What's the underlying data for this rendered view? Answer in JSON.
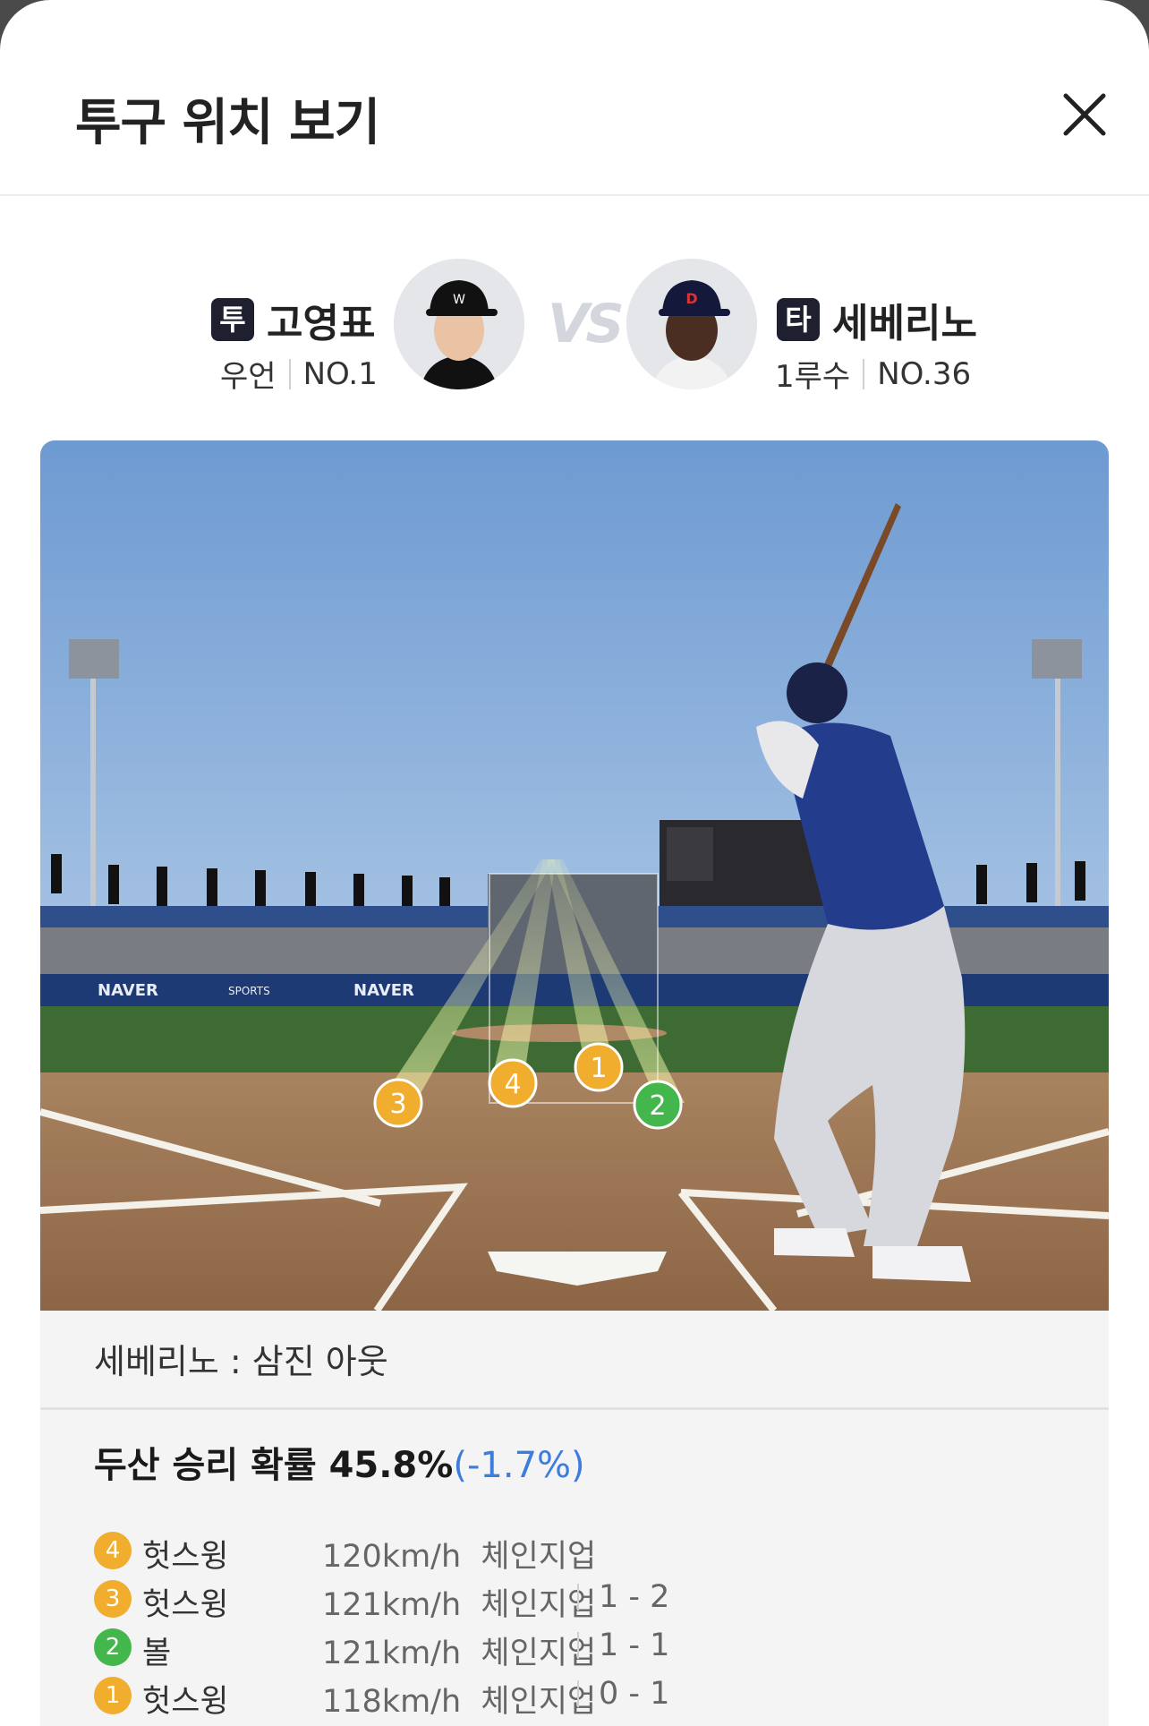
{
  "header": {
    "title": "투구 위치 보기"
  },
  "pitcher": {
    "badge": "투",
    "name": "고영표",
    "position": "우언",
    "number": "NO.1"
  },
  "versus": "VS",
  "batter": {
    "badge": "타",
    "name": "세베리노",
    "position": "1루수",
    "number": "NO.36"
  },
  "result": {
    "text": "세베리노 : 삼진 아웃"
  },
  "win_probability": {
    "label": "두산 승리 확률 45.8%",
    "delta": "(-1.7%)"
  },
  "colors": {
    "strike": "#f0ad2e",
    "ball": "#43b64c",
    "badge": "#1e2030",
    "delta": "#3d7ddb"
  },
  "pitches": [
    {
      "num": "4",
      "result": "헛스윙",
      "speed": "120km/h",
      "type": "체인지업",
      "count": "",
      "kind": "strike"
    },
    {
      "num": "3",
      "result": "헛스윙",
      "speed": "121km/h",
      "type": "체인지업",
      "count": "1 - 2",
      "kind": "strike"
    },
    {
      "num": "2",
      "result": "볼",
      "speed": "121km/h",
      "type": "체인지업",
      "count": "1 - 1",
      "kind": "ball"
    },
    {
      "num": "1",
      "result": "헛스윙",
      "speed": "118km/h",
      "type": "체인지업",
      "count": "0 - 1",
      "kind": "strike"
    }
  ],
  "field_markers": [
    {
      "num": "3",
      "kind": "strike"
    },
    {
      "num": "4",
      "kind": "strike"
    },
    {
      "num": "1",
      "kind": "strike"
    },
    {
      "num": "2",
      "kind": "ball"
    }
  ],
  "signage": {
    "brand": "NAVER",
    "brand2": "SPORTS"
  }
}
